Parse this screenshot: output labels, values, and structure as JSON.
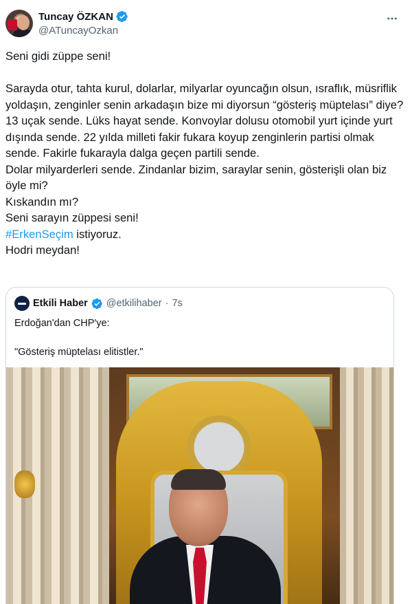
{
  "tweet": {
    "author_name": "Tuncay ÖZKAN",
    "author_handle": "@ATuncayOzkan",
    "verified_color": "#1d9bf0",
    "text_lines": {
      "l1": "Seni gidi züppe seni!",
      "l2": "Sarayda otur, tahta kurul, dolarlar, milyarlar oyuncağın olsun, ısraflık, müsriflik yoldaşın, zenginler senin arkadaşın bize mi diyorsun “gösteriş müptelası” diye? 13 uçak sende. Lüks hayat sende. Konvoylar dolusu otomobil yurt içinde yurt dışında sende. 22 yılda milleti fakir fukara koyup zenginlerin partisi olmak sende. Fakirle fukarayla dalga geçen partili sende.",
      "l3": "Dolar milyarderleri sende. Zindanlar bizim, saraylar senin, gösterişli olan biz öyle mi?",
      "l4": "Kıskandın mı?",
      "l5": "Seni sarayın züppesi seni!",
      "hashtag": "#ErkenSeçim",
      "l6_rest": " istiyoruz.",
      "l7": "Hodri meydan!"
    }
  },
  "quote": {
    "author_name": "Etkili Haber",
    "author_handle": "@etkilihaber",
    "separator": "·",
    "time": "7s",
    "line1": "Erdoğan'dan CHP'ye:",
    "line2": "\"Gösteriş müptelası elitistler.\""
  },
  "icons": {
    "more": "more-horizontal-icon",
    "verified": "verified-badge-icon"
  },
  "colors": {
    "text": "#0f1419",
    "secondary": "#536471",
    "link": "#1d9bf0",
    "border": "#cfd9de"
  }
}
